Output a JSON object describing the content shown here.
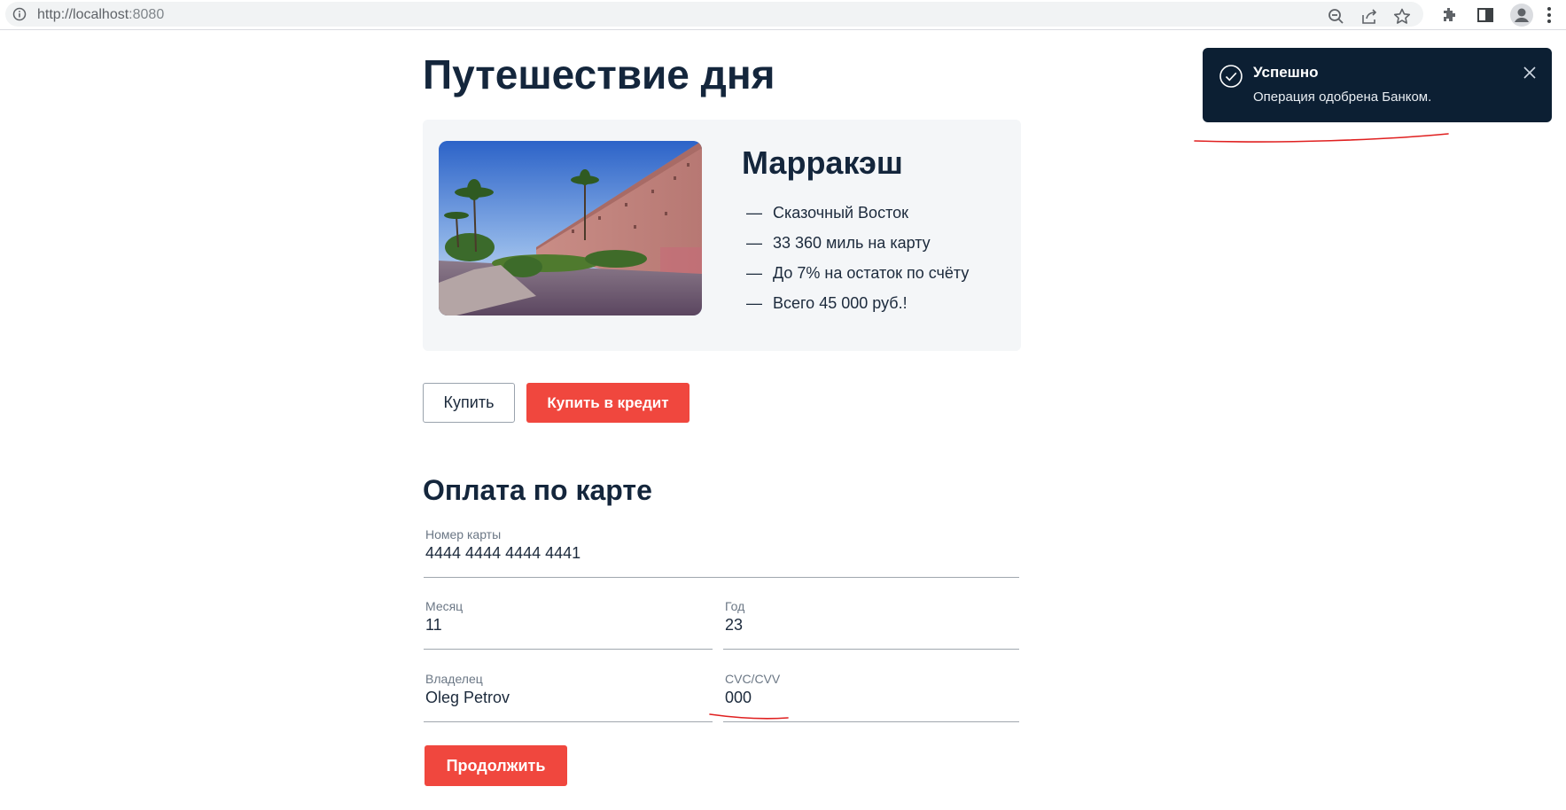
{
  "browser": {
    "url_host": "http://localhost",
    "url_port": ":8080",
    "toolbar_icons": [
      "zoom-out-icon",
      "share-icon",
      "bookmark-star-icon",
      "extensions-icon",
      "side-panel-icon",
      "profile-icon",
      "menu-icon"
    ]
  },
  "page": {
    "title": "Путешествие дня",
    "trip": {
      "city": "Марракэш",
      "features": [
        {
          "dash": "—",
          "text": "Сказочный Восток"
        },
        {
          "dash": "—",
          "text": "33 360 миль на карту"
        },
        {
          "dash": "—",
          "text": "До 7% на остаток по счёту"
        },
        {
          "dash": "—",
          "text": "Всего 45 000 руб.!"
        }
      ]
    },
    "buttons": {
      "buy": "Купить",
      "buy_credit": "Купить в кредит",
      "continue": "Продолжить"
    },
    "payment": {
      "title": "Оплата по карте",
      "card_number": {
        "label": "Номер карты",
        "value": "4444 4444 4444 4441"
      },
      "month": {
        "label": "Месяц",
        "value": "11"
      },
      "year": {
        "label": "Год",
        "value": "23"
      },
      "owner": {
        "label": "Владелец",
        "value": "Oleg Petrov"
      },
      "cvc": {
        "label": "CVC/CVV",
        "value": "000"
      }
    }
  },
  "notification": {
    "title": "Успешно",
    "text": "Операция одобрена Банком.",
    "status": "success"
  },
  "colors": {
    "accent": "#f0473e",
    "heading": "#14263c",
    "toast_bg": "#0c1f33",
    "annotation": "#e02020"
  }
}
